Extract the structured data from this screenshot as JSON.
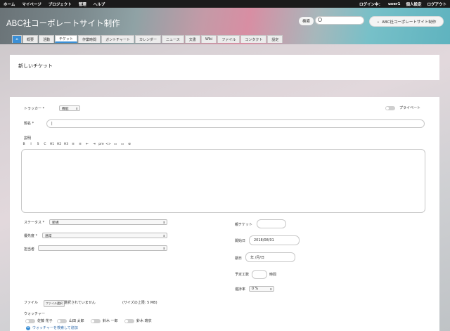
{
  "topbar": {
    "left": [
      "ホーム",
      "マイページ",
      "プロジェクト",
      "管理",
      "ヘルプ"
    ],
    "login": "ログイン中：",
    "user": "user1",
    "personal": "個人設定",
    "logout": "ログアウト"
  },
  "header": {
    "title": "ABC社コーポレートサイト制作",
    "search_label": "検索",
    "project_jump": "ABC社コーポレートサイト制作"
  },
  "tabs": [
    "概要",
    "活動",
    "チケット",
    "作業時間",
    "ガントチャート",
    "カレンダー",
    "ニュース",
    "文書",
    "Wiki",
    "ファイル",
    "コンタクト",
    "設定"
  ],
  "selected_tab": "チケット",
  "page_title": "新しいチケット",
  "form": {
    "tracker_label": "トラッカー",
    "tracker_value": "機能",
    "private_label": "プライベート",
    "subject_label": "題名",
    "description_label": "説明",
    "toolbar": [
      "B",
      "I",
      "S",
      "C",
      "H1",
      "H2",
      "H3",
      "≡",
      "≡",
      "⇤",
      "⇥",
      "pre",
      "<>",
      "▭",
      "▭",
      "⊚"
    ],
    "status_label": "ステータス",
    "status_value": "新規",
    "priority_label": "優先度",
    "priority_value": "通常",
    "assignee_label": "担当者",
    "assignee_value": "",
    "parent_label": "親チケット",
    "start_label": "開始日",
    "start_value": "2018/08/01",
    "due_label": "期日",
    "due_value": "年 /月/日",
    "estimate_label": "予定工数",
    "estimate_unit": "時間",
    "progress_label": "進捗率",
    "progress_value": "0 %",
    "file_label": "ファイル",
    "file_button": "ファイル選択",
    "file_none": "選択されていません",
    "file_limit": "(サイズの上限: 5 MB)",
    "watchers_label": "ウォッチャー",
    "watchers": [
      "佐藤 花子",
      "山田 太郎",
      "鈴木 一郎",
      "鈴木 瑞衣"
    ],
    "add_watcher": "ウォッチャーを検索して追加"
  }
}
